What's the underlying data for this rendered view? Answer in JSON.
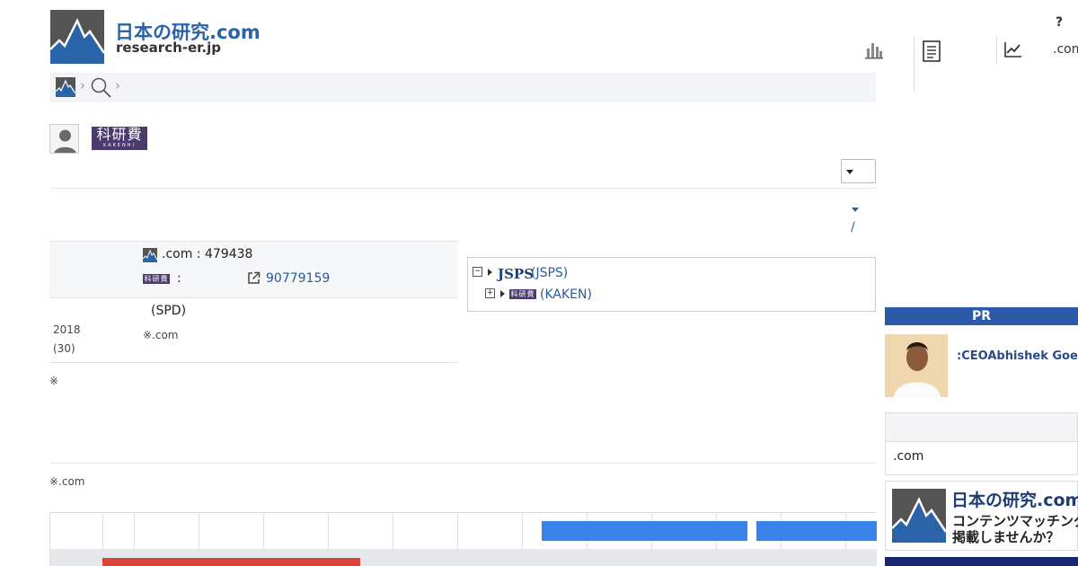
{
  "header": {
    "logo_jp": "日本の研究.com",
    "logo_en": "research-er.jp",
    "help": "?",
    "nav_com": ".com"
  },
  "profile": {
    "kaken_badge_top": "科研費",
    "kaken_badge_bottom": "KAKENHI"
  },
  "info": {
    "site_id_label": ".com : 479438",
    "kaken_colon": ":",
    "kaken_number": "90779159",
    "position": "(SPD)",
    "year": "2018",
    "year_jp": "(30)",
    "note_com": "※.com"
  },
  "tree": {
    "item1_brand": "JSPS",
    "item1_label": "(JSPS)",
    "item2_label": "(KAKEN)",
    "mini_kaken": "科研費"
  },
  "notes": {
    "asterisk": "※",
    "bottom_note": "※.com"
  },
  "sidebar": {
    "pr_label": "PR",
    "pr_text": ":CEOAbhishek Goel",
    "com_label": ".com",
    "ad_title": "日本の研究.com",
    "ad_line1": "コンテンツマッチング",
    "ad_line2": "掲載しませんか？"
  },
  "misc": {
    "slash": "/"
  },
  "icons": [
    "bar-chart-icon",
    "document-icon",
    "line-chart-icon",
    "search-icon",
    "user-icon",
    "external-link-icon"
  ],
  "colors": {
    "brand_blue": "#2a64a8",
    "kaken_purple": "#4a3a6e",
    "pr_bar": "#2b5aa8",
    "timeline_blue": "#3b82e8",
    "timeline_red": "#d9453a"
  }
}
